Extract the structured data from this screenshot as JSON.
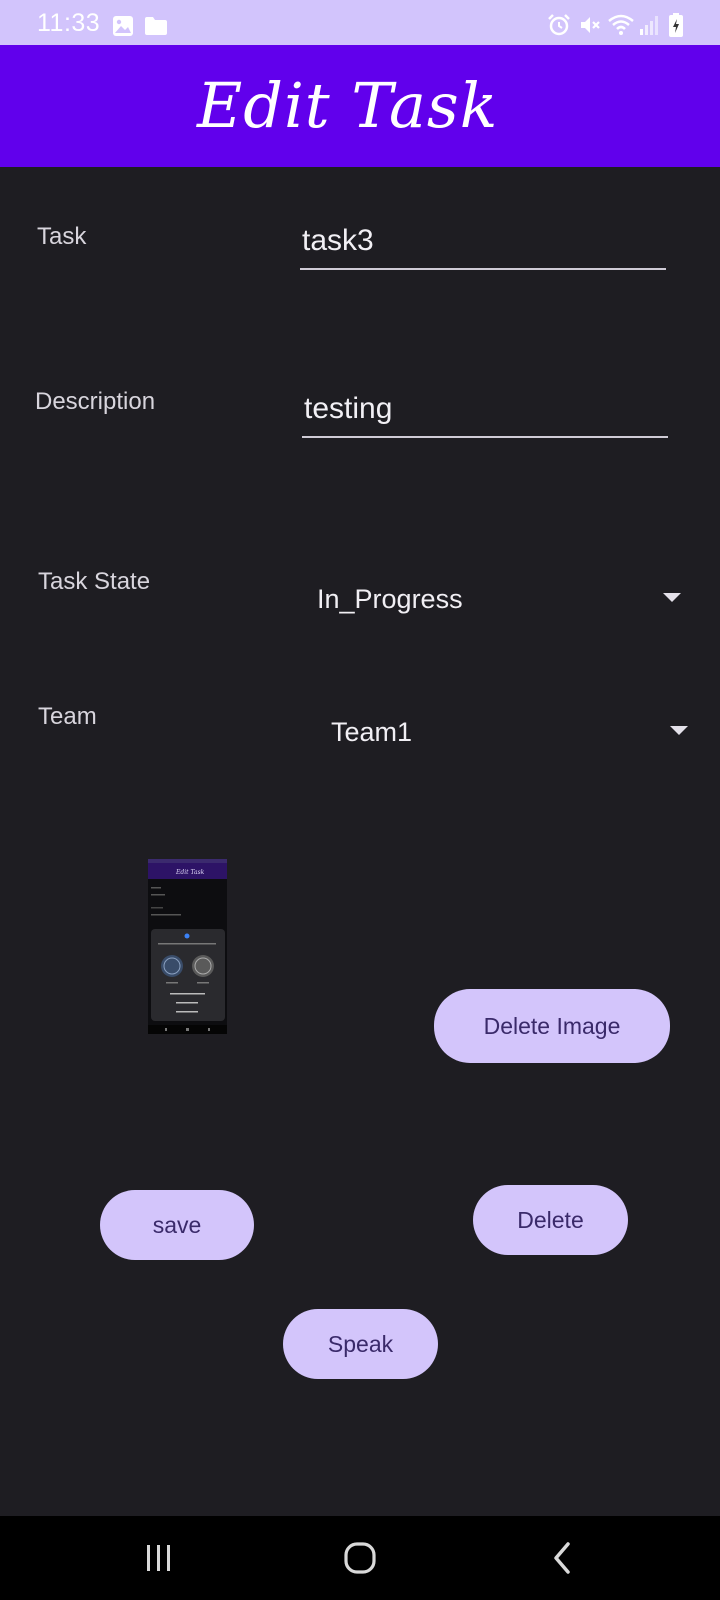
{
  "status_bar": {
    "time": "11:33",
    "left_icons": [
      "image-icon",
      "folder-icon"
    ],
    "right_icons": [
      "alarm-icon",
      "mute-icon",
      "wifi-icon",
      "signal-icon",
      "battery-charging-icon"
    ]
  },
  "app_bar": {
    "title": "Edit Task",
    "background": "#6100ec"
  },
  "form": {
    "task_label": "Task",
    "task_value": "task3",
    "description_label": "Description",
    "description_value": "testing",
    "state_label": "Task State",
    "state_value": "In_Progress",
    "team_label": "Team",
    "team_value": "Team1"
  },
  "buttons": {
    "delete_image": "Delete Image",
    "save": "save",
    "delete": "Delete",
    "speak": "Speak"
  },
  "thumbnail": {
    "title": "Edit Task"
  },
  "nav_bar": {
    "icons": [
      "recents-icon",
      "home-icon",
      "back-icon"
    ]
  },
  "colors": {
    "status_bar": "#d2c4fc",
    "background": "#1e1d22",
    "button": "#d3c5fb",
    "button_text": "#3a2a6a"
  }
}
